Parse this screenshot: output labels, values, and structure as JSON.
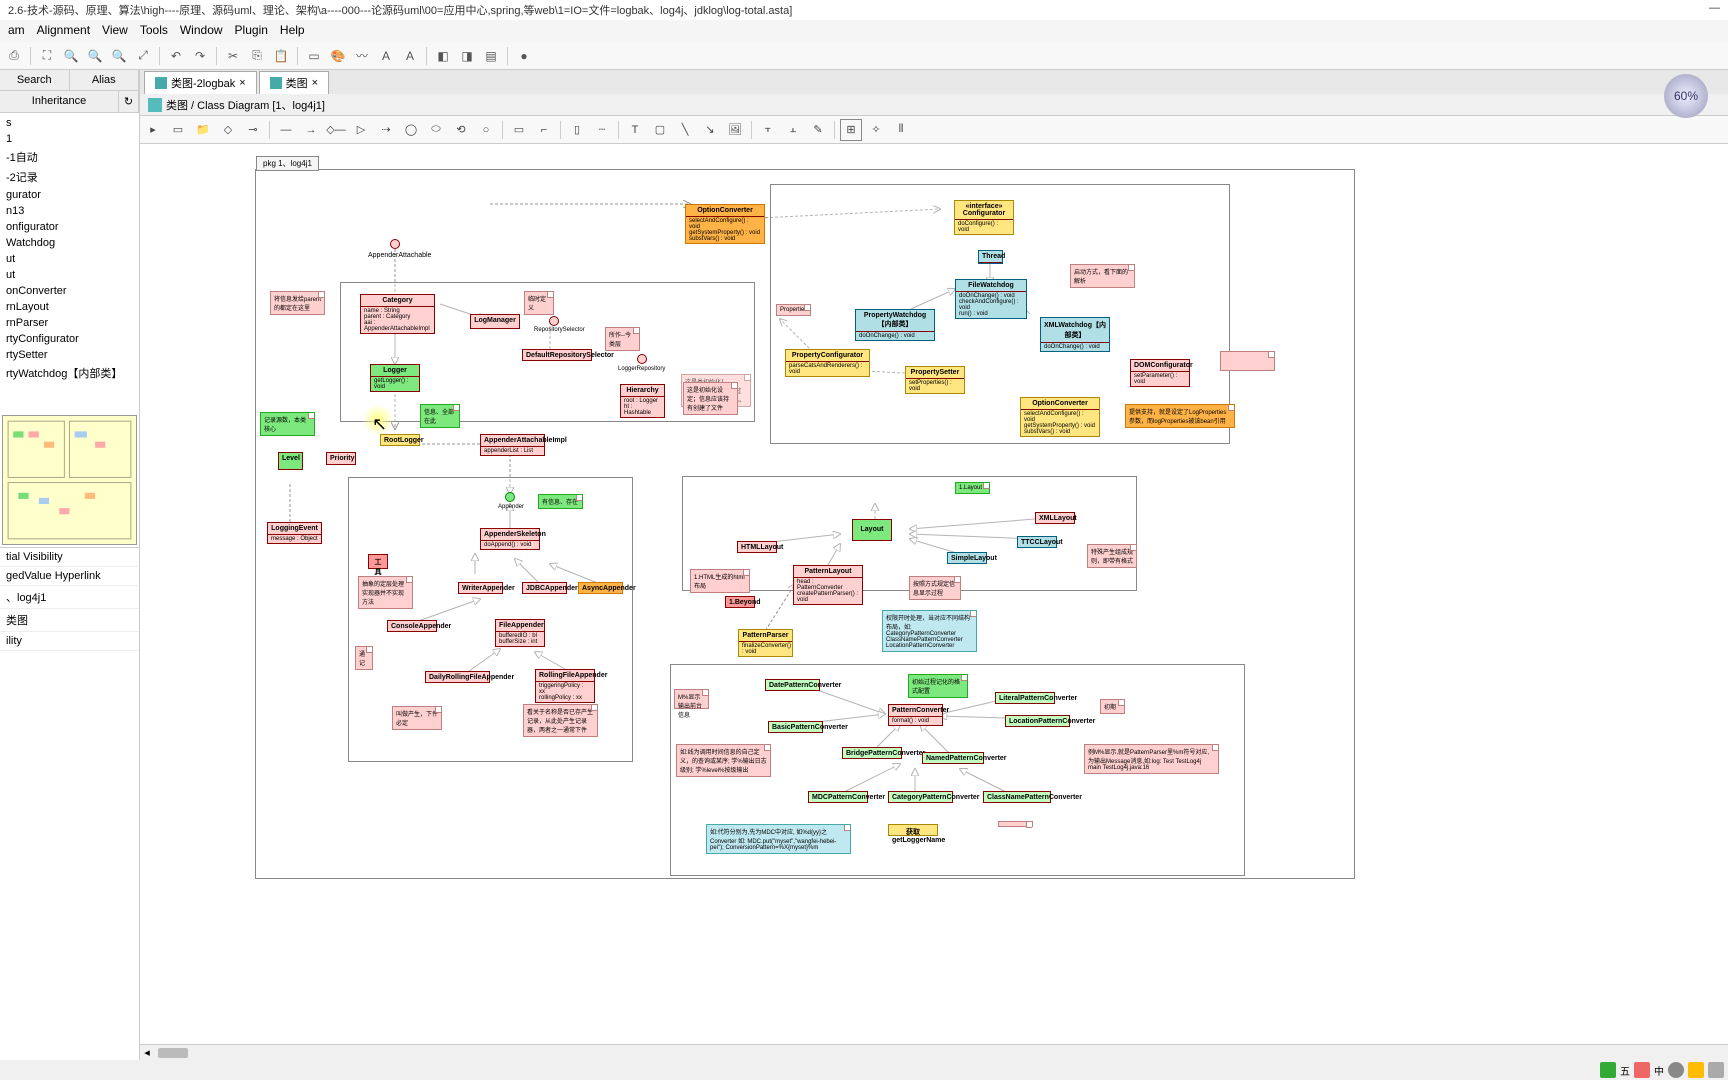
{
  "title": "2.6-技术-源码、原理、算法\\high----原理、源码uml、理论、架构\\a----000---论源码uml\\00=应用中心,spring,等web\\1=IO=文件=logbak、log4j、jdklog\\log-total.asta]",
  "menu": [
    "am",
    "Alignment",
    "View",
    "Tools",
    "Window",
    "Plugin",
    "Help"
  ],
  "left_tabs_top": [
    "Search",
    "Alias"
  ],
  "left_tabs_bottom": [
    "Inheritance"
  ],
  "tree": [
    "s",
    "1",
    "-1自动",
    "-2记录",
    "gurator",
    "n13",
    "onfigurator",
    "Watchdog",
    "ut",
    "ut",
    "onConverter",
    "rnLayout",
    "rnParser",
    "rtyConfigurator",
    "rtySetter",
    "rtyWatchdog【内部类】"
  ],
  "props": [
    "tial Visibility",
    "gedValue    Hyperlink",
    "、log4j1",
    "类图",
    "ility"
  ],
  "tabs": [
    {
      "label": "类图-2logbak"
    },
    {
      "label": "类图"
    }
  ],
  "breadcrumb": "类图 / Class Diagram [1、log4j1]",
  "zoom": "60%",
  "package_label": "pkg 1、log4j1",
  "classes": {
    "OptionConverter": {
      "name": "OptionConverter",
      "ops": [
        "selectAndConfigure() : void",
        "getSystemProperty() : void",
        "substVars() : void"
      ]
    },
    "Configurator": {
      "name": "«interface»\nConfigurator",
      "ops": [
        "doConfigure() : void"
      ]
    },
    "Thread": {
      "name": "Thread"
    },
    "FileWatchdog": {
      "name": "FileWatchdog",
      "ops": [
        "doOnChange() : void",
        "checkAndConfigure() : void",
        "run() : void"
      ]
    },
    "PropertyWatchdog": {
      "name": "PropertyWatchdog【内部类】",
      "ops": [
        "doOnChange() : void"
      ]
    },
    "XMLWatchdog": {
      "name": "XMLWatchdog【内部类】",
      "ops": [
        "doOnChange() : void"
      ]
    },
    "PropertyConfigurator": {
      "name": "PropertyConfigurator",
      "ops": [
        "parseCatsAndRenderers() : void"
      ]
    },
    "PropertySetter": {
      "name": "PropertySetter",
      "ops": [
        "setProperties() : void"
      ]
    },
    "DOMConfigurator": {
      "name": "DOMConfigurator",
      "ops": [
        "setParameter() : void"
      ]
    },
    "OptionConverter2": {
      "name": "OptionConverter",
      "ops": [
        "selectAndConfigure() : void",
        "getSystemProperty() : void",
        "substVars() : void"
      ]
    },
    "Category": {
      "name": "Category",
      "attrs": [
        "name : String",
        "parent : Category",
        "aai : AppenderAttachableImpl"
      ]
    },
    "LogManager": {
      "name": "LogManager"
    },
    "DefaultRepositorySelector": {
      "name": "DefaultRepositorySelector"
    },
    "RepositorySelector": {
      "name": "RepositorySelector"
    },
    "LoggerRepository": {
      "name": "LoggerRepository"
    },
    "Hierarchy": {
      "name": "Hierarchy",
      "attrs": [
        "root : Logger",
        "ht : Hashtable"
      ]
    },
    "Logger": {
      "name": "Logger",
      "ops": [
        "getLogger() : void"
      ]
    },
    "RootLogger": {
      "name": "RootLogger"
    },
    "AppenderAttachableImpl": {
      "name": "AppenderAttachableImpl",
      "attrs": [
        "appenderList : List"
      ]
    },
    "AppenderAttachable": {
      "name": "AppenderAttachable"
    },
    "Level": {
      "name": "Level"
    },
    "Priority": {
      "name": "Priority"
    },
    "LoggingEvent": {
      "name": "LoggingEvent",
      "attrs": [
        "message : Object"
      ]
    },
    "Appender": {
      "name": "Appender"
    },
    "AppenderSkeleton": {
      "name": "AppenderSkeleton",
      "ops": [
        "doAppend() : void"
      ]
    },
    "WriterAppender": {
      "name": "WriterAppender"
    },
    "JDBCAppender": {
      "name": "JDBCAppender"
    },
    "AsyncAppender": {
      "name": "AsyncAppender"
    },
    "ConsoleAppender": {
      "name": "ConsoleAppender"
    },
    "FileAppender": {
      "name": "FileAppender",
      "attrs": [
        "bufferedIO : bl",
        "bufferSize : int"
      ]
    },
    "DailyRollingFileAppender": {
      "name": "DailyRollingFileAppender"
    },
    "RollingFileAppender": {
      "name": "RollingFileAppender",
      "attrs": [
        "triggeringPolicy : xx",
        "rollingPolicy : xx"
      ]
    },
    "Layout": {
      "name": "Layout"
    },
    "HTMLLayout": {
      "name": "HTMLLayout"
    },
    "XMLLayout": {
      "name": "XMLLayout"
    },
    "TTCCLayout": {
      "name": "TTCCLayout"
    },
    "SimpleLayout": {
      "name": "SimpleLayout"
    },
    "PatternLayout": {
      "name": "PatternLayout",
      "attrs": [
        "head : PatternConverter"
      ],
      "ops": [
        "createPatternParser() : void"
      ]
    },
    "PatternParser": {
      "name": "PatternParser",
      "ops": [
        "finalizeConverter() : void"
      ]
    },
    "PatternConverter": {
      "name": "PatternConverter",
      "ops": [
        "format() : void"
      ]
    },
    "DatePatternConverter": {
      "name": "DatePatternConverter"
    },
    "LiteralPatternConverter": {
      "name": "LiteralPatternConverter"
    },
    "BasicPatternConverter": {
      "name": "BasicPatternConverter"
    },
    "LocationPatternConverter": {
      "name": "LocationPatternConverter"
    },
    "BridgePatternConverter": {
      "name": "BridgePatternConverter"
    },
    "NamedPatternConverter": {
      "name": "NamedPatternConverter"
    },
    "MDCPatternConverter": {
      "name": "MDCPatternConverter"
    },
    "CategoryPatternConverter": {
      "name": "CategoryPatternConverter"
    },
    "ClassNamePatternConverter": {
      "name": "ClassNamePatternConverter"
    }
  },
  "notes": {
    "n1": "启动方式，看下面的解析",
    "n2": "Properties",
    "n3": "这是类初始化！给:Logger设定很多过滤条件；定义了关系。",
    "n4": "提供支持，就是设定了LogProperties参数，而logProperties被该bean引用",
    "n5": "将信息发给parent的都定在这里",
    "n6": "临时定义",
    "n7": "所作--今类层",
    "n8": "这是初始化设定；信息应该持有创建了文件",
    "n9": "记录源数，本类核心",
    "n10": "信息、全部在此",
    "n11": "有信息、存在",
    "n12": "所查有的记录器都放在Hashtable里，名称与实例对应",
    "n13": "工具",
    "n14": "抽象的定层处理实现器并不实现方法",
    "n15": "通记",
    "n16": "叫做产生，下件必定",
    "n17": "看关于名称是否已存产生记录，从此处产生记录器，两者之一通常下件",
    "n18": "1.HTML生成的html布局",
    "n19": "按照方式规定信息显示过程",
    "n20": "特殊产生组成规则，即带有格式",
    "n21": "权限开时处理，当对应不同结构布局，如:  CategoryPatternConverter  ClassNamePatternConverter  LocationPatternConverter",
    "n22": "M%显示输出前台信息",
    "n23": "初期",
    "n24": "如:线为调用时间信息的自己定义，的查询或某序;  学%输出日志级别;  学%level%按级输出",
    "n25": "例M%显示,就是PatternParser里%m符号对应,为输出Message消息,如:log:  Test TestLog4j main TestLog4j.java:16",
    "n26": "初始过程记化的格式配置",
    "n27": "如:代符分别为,先为MDC中对应,  如%d{yy}之Converter  如:  MDC.put(\"myset\",\"wangfei-hebei-pei\");  ConversionPattern=%X{myset}%m",
    "n28": "获取getLoggerName",
    "n29": "1.Layout"
  },
  "tray": [
    "五",
    "中",
    "③",
    ":)"
  ]
}
